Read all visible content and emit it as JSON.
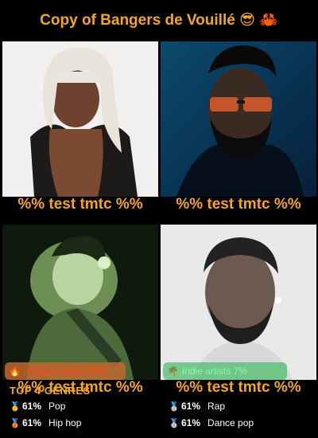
{
  "header": {
    "title": "Copy of Bangers de Vouillé 😎 🦀"
  },
  "tiles": [
    {
      "caption": "%% test tmtc %%"
    },
    {
      "caption": "%% test tmtc %%"
    },
    {
      "caption": "%% test tmtc %%"
    },
    {
      "caption": "%% test tmtc %%"
    }
  ],
  "badges": {
    "popular": {
      "icon": "🔥",
      "label": "Popular artists 93%"
    },
    "indie": {
      "icon": "🌴",
      "label": "Indie artists 7%"
    }
  },
  "genres": {
    "title": "TOP 4 GENRES",
    "items": [
      {
        "medal": "🥇",
        "percent": "61%",
        "name": "Pop"
      },
      {
        "medal": "🥈",
        "percent": "61%",
        "name": "Rap"
      },
      {
        "medal": "🥉",
        "percent": "61%",
        "name": "Hip hop"
      },
      {
        "medal": "🥈",
        "percent": "61%",
        "name": "Dance pop"
      }
    ]
  },
  "colors": {
    "accent": "#f5a623",
    "background": "#000000"
  }
}
